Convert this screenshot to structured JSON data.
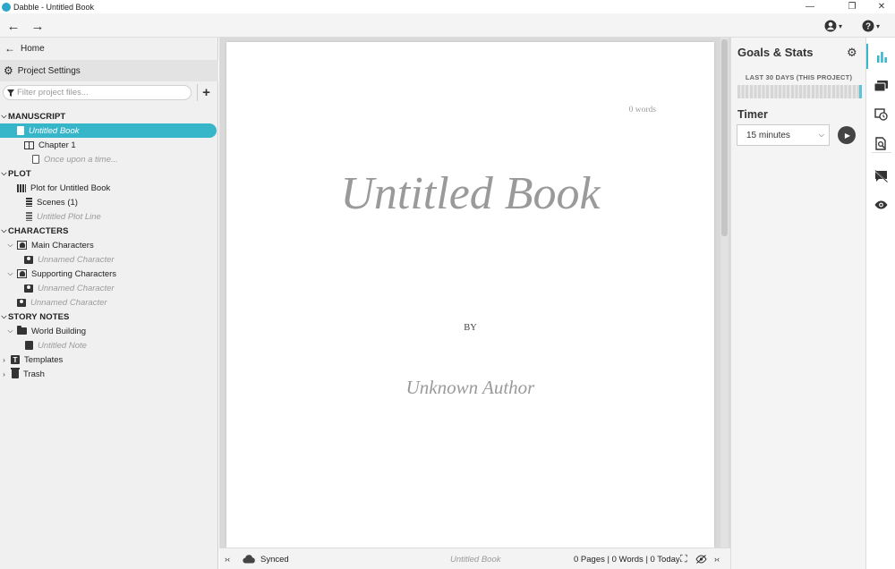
{
  "window": {
    "title": "Dabble - Untitled Book",
    "minimize": "—",
    "restore": "❐",
    "close": "✕"
  },
  "toolbar": {
    "back_icon": "←",
    "forward_icon": "→",
    "account_icon": "account-icon",
    "help_icon": "help-icon",
    "caret": "▾"
  },
  "sidebar": {
    "home_label": "Home",
    "settings_label": "Project Settings",
    "filter_placeholder": "Filter project files...",
    "add_label": "+",
    "tree": [
      {
        "label": "MANUSCRIPT",
        "type": "section"
      },
      {
        "label": "Untitled Book",
        "type": "item",
        "placeholder": true,
        "selected": true
      },
      {
        "label": "Chapter 1",
        "type": "item"
      },
      {
        "label": "Once upon a time...",
        "type": "item",
        "placeholder": true
      },
      {
        "label": "PLOT",
        "type": "section"
      },
      {
        "label": "Plot for Untitled Book",
        "type": "item"
      },
      {
        "label": "Scenes  (1)",
        "type": "item"
      },
      {
        "label": "Untitled Plot Line",
        "type": "item",
        "placeholder": true
      },
      {
        "label": "CHARACTERS",
        "type": "section"
      },
      {
        "label": "Main Characters",
        "type": "item"
      },
      {
        "label": "Unnamed Character",
        "type": "item",
        "placeholder": true
      },
      {
        "label": "Supporting Characters",
        "type": "item"
      },
      {
        "label": "Unnamed Character",
        "type": "item",
        "placeholder": true
      },
      {
        "label": "Unnamed Character",
        "type": "item",
        "placeholder": true
      },
      {
        "label": "STORY NOTES",
        "type": "section"
      },
      {
        "label": "World Building",
        "type": "item"
      },
      {
        "label": "Untitled Note",
        "type": "item",
        "placeholder": true
      },
      {
        "label": "Templates",
        "type": "item"
      },
      {
        "label": "Trash",
        "type": "item"
      }
    ]
  },
  "editor": {
    "word_count": "0 words",
    "book_title": "Untitled Book",
    "by": "BY",
    "author": "Unknown Author"
  },
  "status": {
    "collapse_left": "›‹",
    "sync_label": "Synced",
    "doc_title": "Untitled Book",
    "stats": "0 Pages | 0 Words | 0 Today",
    "collapse_right": "›‹"
  },
  "goals": {
    "title": "Goals & Stats",
    "subtitle": "LAST 30 DAYS (THIS PROJECT)",
    "timer_label": "Timer",
    "timer_value": "15 minutes",
    "play_icon": "▶",
    "accent_color": "#37b5c9"
  },
  "rail": {
    "icons": [
      "stats-icon",
      "comments-icon",
      "history-icon",
      "find-icon",
      "hide-comments-icon",
      "preview-icon"
    ]
  }
}
